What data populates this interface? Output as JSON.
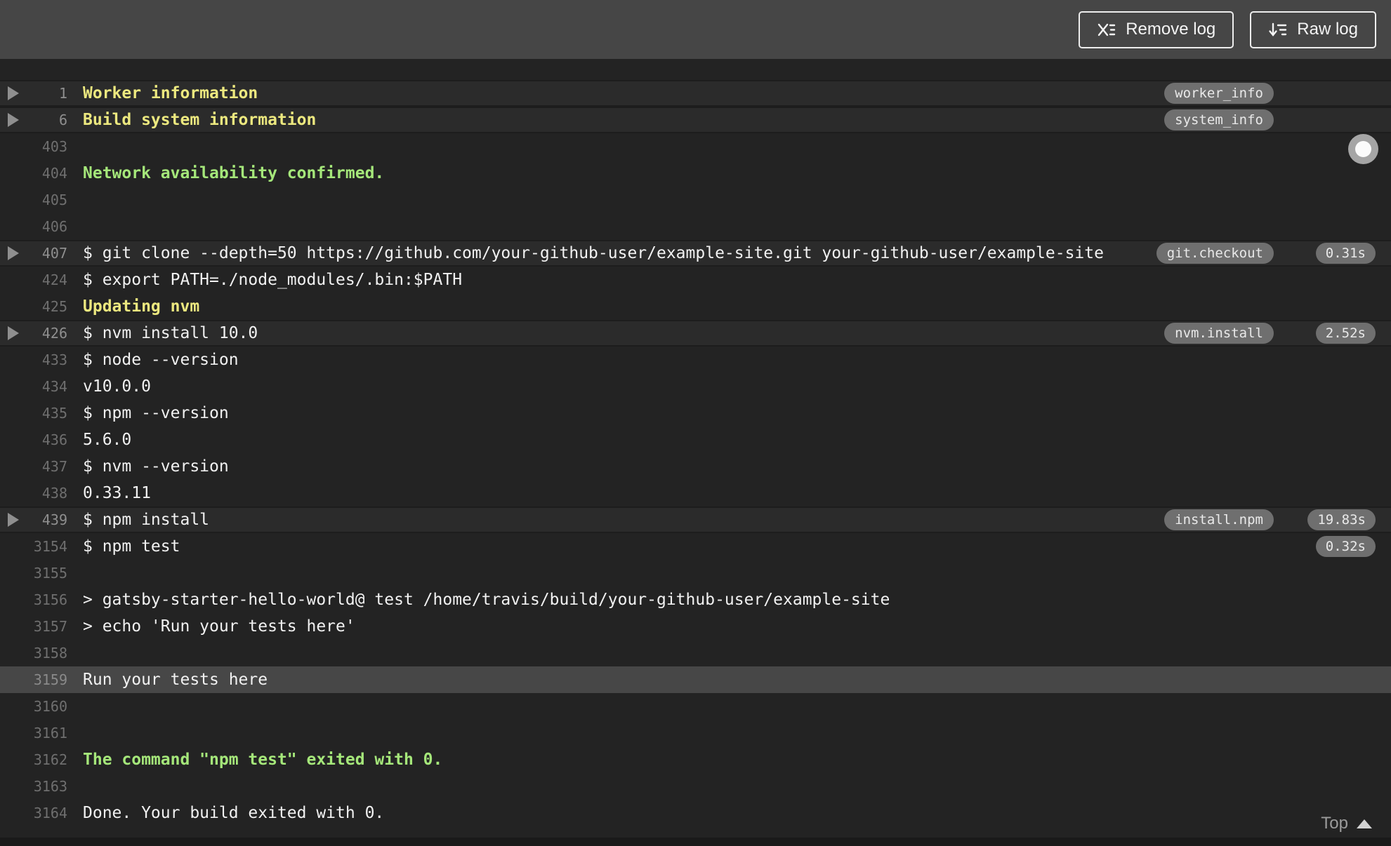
{
  "toolbar": {
    "remove_log_label": "Remove log",
    "raw_log_label": "Raw log"
  },
  "log": {
    "top_link_label": "Top",
    "rows": [
      {
        "line": "1",
        "text": "Worker information",
        "color": "yellow",
        "fold_header": true,
        "tag": "worker_info",
        "duration": null,
        "highlighted": false
      },
      {
        "line": "6",
        "text": "Build system information",
        "color": "yellow",
        "fold_header": true,
        "tag": "system_info",
        "duration": null,
        "highlighted": false
      },
      {
        "line": "403",
        "text": "",
        "color": "plain",
        "fold_header": false,
        "tag": null,
        "duration": null,
        "highlighted": false
      },
      {
        "line": "404",
        "text": "Network availability confirmed.",
        "color": "green",
        "fold_header": false,
        "tag": null,
        "duration": null,
        "highlighted": false
      },
      {
        "line": "405",
        "text": "",
        "color": "plain",
        "fold_header": false,
        "tag": null,
        "duration": null,
        "highlighted": false
      },
      {
        "line": "406",
        "text": "",
        "color": "plain",
        "fold_header": false,
        "tag": null,
        "duration": null,
        "highlighted": false
      },
      {
        "line": "407",
        "text": "$ git clone --depth=50 https://github.com/your-github-user/example-site.git your-github-user/example-site",
        "color": "plain",
        "fold_header": true,
        "tag": "git.checkout",
        "duration": "0.31s",
        "highlighted": false
      },
      {
        "line": "424",
        "text": "$ export PATH=./node_modules/.bin:$PATH",
        "color": "plain",
        "fold_header": false,
        "tag": null,
        "duration": null,
        "highlighted": false
      },
      {
        "line": "425",
        "text": "Updating nvm",
        "color": "yellow",
        "fold_header": false,
        "tag": null,
        "duration": null,
        "highlighted": false
      },
      {
        "line": "426",
        "text": "$ nvm install 10.0",
        "color": "plain",
        "fold_header": true,
        "tag": "nvm.install",
        "duration": "2.52s",
        "highlighted": false
      },
      {
        "line": "433",
        "text": "$ node --version",
        "color": "plain",
        "fold_header": false,
        "tag": null,
        "duration": null,
        "highlighted": false
      },
      {
        "line": "434",
        "text": "v10.0.0",
        "color": "plain",
        "fold_header": false,
        "tag": null,
        "duration": null,
        "highlighted": false
      },
      {
        "line": "435",
        "text": "$ npm --version",
        "color": "plain",
        "fold_header": false,
        "tag": null,
        "duration": null,
        "highlighted": false
      },
      {
        "line": "436",
        "text": "5.6.0",
        "color": "plain",
        "fold_header": false,
        "tag": null,
        "duration": null,
        "highlighted": false
      },
      {
        "line": "437",
        "text": "$ nvm --version",
        "color": "plain",
        "fold_header": false,
        "tag": null,
        "duration": null,
        "highlighted": false
      },
      {
        "line": "438",
        "text": "0.33.11",
        "color": "plain",
        "fold_header": false,
        "tag": null,
        "duration": null,
        "highlighted": false
      },
      {
        "line": "439",
        "text": "$ npm install",
        "color": "plain",
        "fold_header": true,
        "tag": "install.npm",
        "duration": "19.83s",
        "highlighted": false
      },
      {
        "line": "3154",
        "text": "$ npm test",
        "color": "plain",
        "fold_header": false,
        "tag": null,
        "duration": "0.32s",
        "highlighted": false
      },
      {
        "line": "3155",
        "text": "",
        "color": "plain",
        "fold_header": false,
        "tag": null,
        "duration": null,
        "highlighted": false
      },
      {
        "line": "3156",
        "text": "> gatsby-starter-hello-world@ test /home/travis/build/your-github-user/example-site",
        "color": "plain",
        "fold_header": false,
        "tag": null,
        "duration": null,
        "highlighted": false
      },
      {
        "line": "3157",
        "text": "> echo 'Run your tests here'",
        "color": "plain",
        "fold_header": false,
        "tag": null,
        "duration": null,
        "highlighted": false
      },
      {
        "line": "3158",
        "text": "",
        "color": "plain",
        "fold_header": false,
        "tag": null,
        "duration": null,
        "highlighted": false
      },
      {
        "line": "3159",
        "text": "Run your tests here",
        "color": "plain",
        "fold_header": false,
        "tag": null,
        "duration": null,
        "highlighted": true
      },
      {
        "line": "3160",
        "text": "",
        "color": "plain",
        "fold_header": false,
        "tag": null,
        "duration": null,
        "highlighted": false
      },
      {
        "line": "3161",
        "text": "",
        "color": "plain",
        "fold_header": false,
        "tag": null,
        "duration": null,
        "highlighted": false
      },
      {
        "line": "3162",
        "text": "The command \"npm test\" exited with 0.",
        "color": "green",
        "fold_header": false,
        "tag": null,
        "duration": null,
        "highlighted": false
      },
      {
        "line": "3163",
        "text": "",
        "color": "plain",
        "fold_header": false,
        "tag": null,
        "duration": null,
        "highlighted": false
      },
      {
        "line": "3164",
        "text": "Done. Your build exited with 0.",
        "color": "plain",
        "fold_header": false,
        "tag": null,
        "duration": null,
        "highlighted": false
      }
    ]
  },
  "colors": {
    "toolbar_bg": "#464646",
    "log_bg": "#232323",
    "fold_row_bg": "#2b2b2b",
    "highlight_row_bg": "#474747",
    "badge_bg": "#6f6f6f",
    "log_yellow": "#ece87f",
    "log_green": "#a5e77a",
    "log_white": "#f1f1f1"
  }
}
